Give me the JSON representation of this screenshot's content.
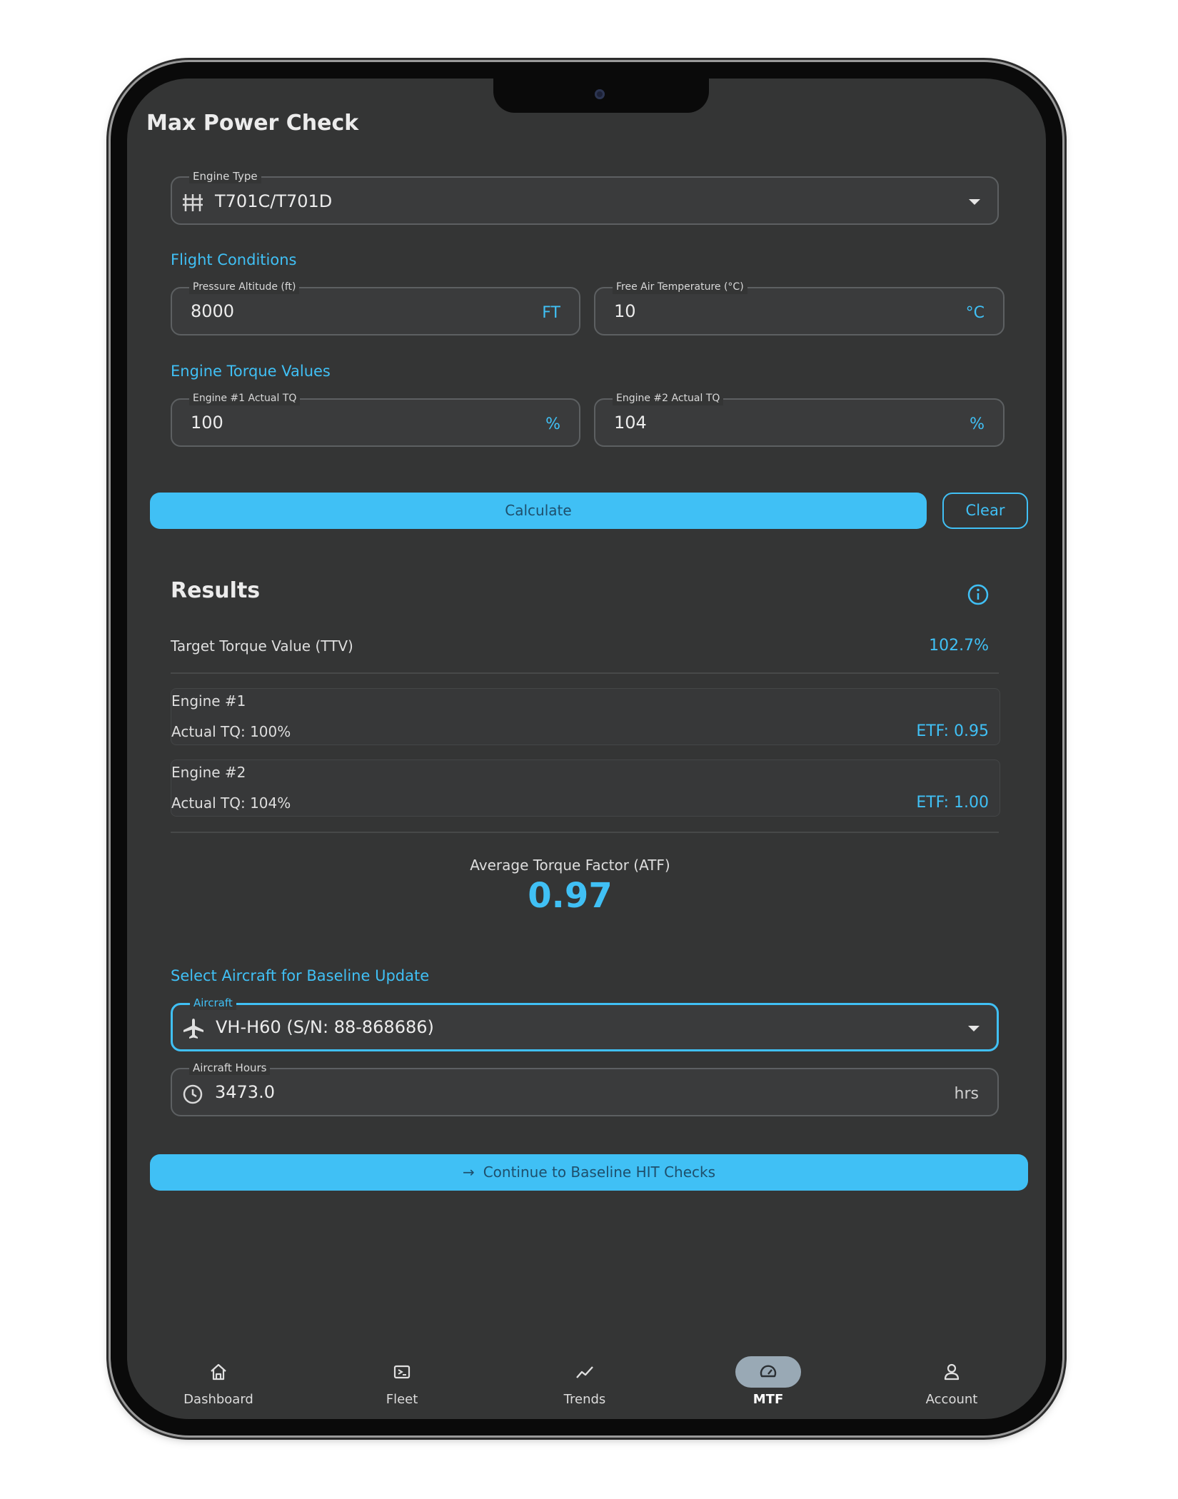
{
  "app": {
    "title": "Max Power Check"
  },
  "engine_type": {
    "label": "Engine Type",
    "value": "T701C/T701D",
    "icon": "engine-icon"
  },
  "flight_conditions": {
    "title": "Flight Conditions",
    "pressure_altitude": {
      "label": "Pressure Altitude (ft)",
      "value": "8000",
      "unit": "FT"
    },
    "free_air_temperature": {
      "label": "Free Air Temperature (°C)",
      "value": "10",
      "unit": "°C"
    }
  },
  "engine_torque": {
    "title": "Engine Torque Values",
    "engine1": {
      "label": "Engine #1 Actual TQ",
      "value": "100",
      "unit": "%"
    },
    "engine2": {
      "label": "Engine #2 Actual TQ",
      "value": "104",
      "unit": "%"
    }
  },
  "actions": {
    "calculate": "Calculate",
    "clear": "Clear"
  },
  "results": {
    "title": "Results",
    "ttv_label": "Target Torque Value (TTV)",
    "ttv_value": "102.7%",
    "engines": [
      {
        "name": "Engine #1",
        "actual": "Actual TQ: 100%",
        "etf": "ETF: 0.95"
      },
      {
        "name": "Engine #2",
        "actual": "Actual TQ: 104%",
        "etf": "ETF: 1.00"
      }
    ],
    "atf_label": "Average Torque Factor (ATF)",
    "atf_value": "0.97"
  },
  "baseline": {
    "title": "Select Aircraft for Baseline Update",
    "aircraft": {
      "label": "Aircraft",
      "value": "VH-H60 (S/N: 88-868686)",
      "icon": "airplane-icon"
    },
    "hours": {
      "label": "Aircraft Hours",
      "value": "3473.0",
      "unit": "hrs",
      "icon": "clock-icon"
    },
    "continue_label": "Continue to Baseline HIT Checks"
  },
  "nav": {
    "items": [
      {
        "label": "Dashboard",
        "icon": "home-icon"
      },
      {
        "label": "Fleet",
        "icon": "fleet-icon"
      },
      {
        "label": "Trends",
        "icon": "trends-icon"
      },
      {
        "label": "MTF",
        "icon": "gauge-icon",
        "active": true
      },
      {
        "label": "Account",
        "icon": "account-icon"
      }
    ]
  },
  "colors": {
    "accent": "#40c0f5",
    "background": "#343535",
    "active_pill": "#99a9b5"
  }
}
